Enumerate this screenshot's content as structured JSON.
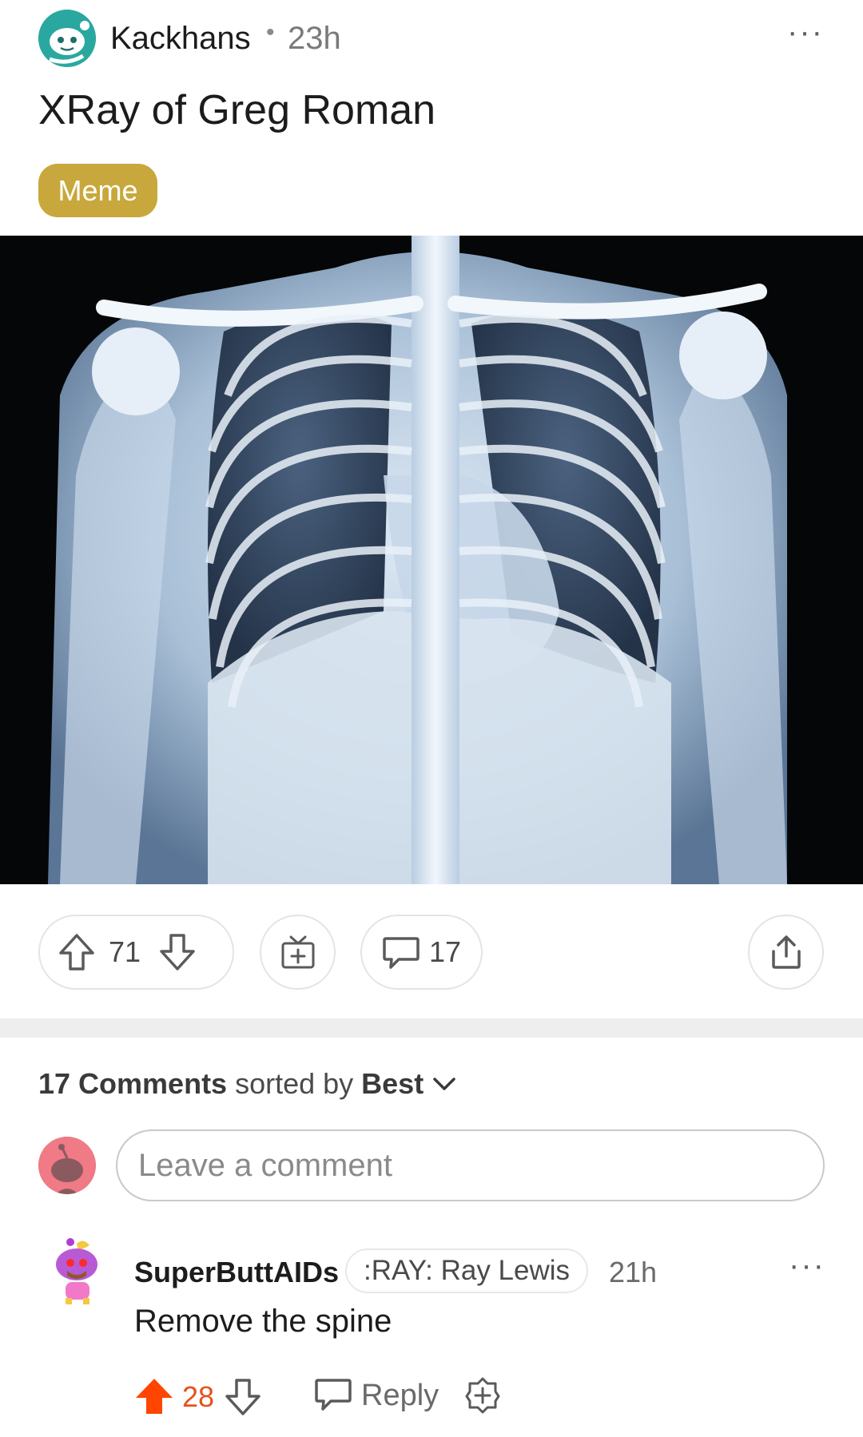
{
  "post": {
    "author": "Kackhans",
    "separator": "•",
    "age": "23h",
    "more": "···",
    "title": "XRay of Greg Roman",
    "flair": "Meme",
    "flair_color": "#c8a83c"
  },
  "actions": {
    "score": "71",
    "comments": "17"
  },
  "comments_header": {
    "count_label": "17 Comments",
    "sorted_by": "sorted by",
    "sort": "Best",
    "placeholder": "Leave a comment"
  },
  "comments": [
    {
      "user": "SuperButtAIDs",
      "flair": ":RAY: Ray Lewis",
      "age": "21h",
      "more": "···",
      "body": "Remove the spine",
      "score": "28",
      "reply_label": "Reply"
    }
  ],
  "colors": {
    "upvoted": "#ff4500",
    "score_text": "#e8501c",
    "avatar_teal": "#2aa8a0",
    "avatar_pink": "#f07a86"
  }
}
